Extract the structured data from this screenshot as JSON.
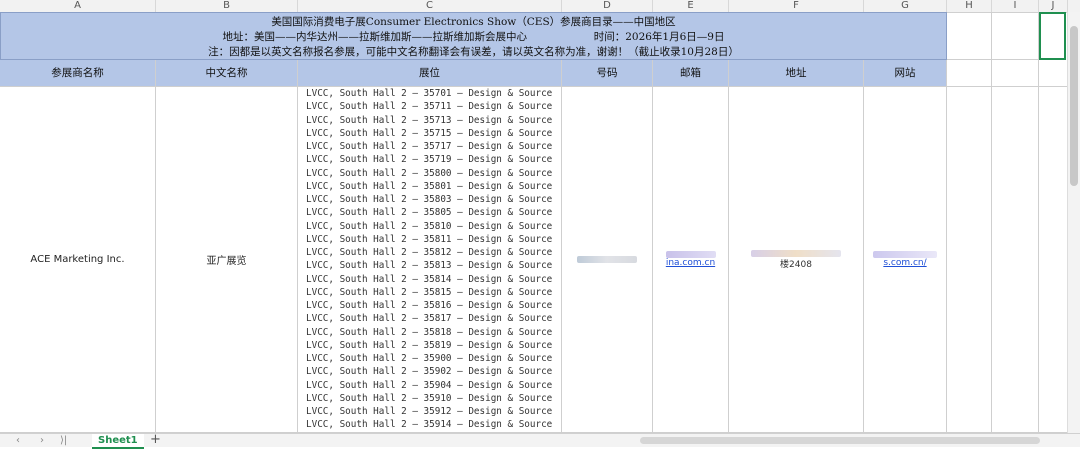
{
  "columns": [
    "A",
    "B",
    "C",
    "D",
    "E",
    "F",
    "G",
    "H",
    "I",
    "J"
  ],
  "title": {
    "line1": "美国国际消费电子展Consumer Electronics Show（CES）参展商目录——中国地区",
    "line2": "地址：美国——内华达州——拉斯维加斯——拉斯维加斯会展中心",
    "line2b": "时间：2026年1月6日—9日",
    "line3": "注：因都是以英文名称报名参展，可能中文名称翻译会有误差，请以英文名称为准，谢谢！（截止收录10月28日）"
  },
  "headers": [
    "参展商名称",
    "中文名称",
    "展位",
    "号码",
    "邮箱",
    "地址",
    "网站"
  ],
  "row": {
    "exhibitor": "ACE Marketing Inc.",
    "chinese_name": "亚广展览",
    "booths": [
      "LVCC, South Hall 2 — 35701 — Design & Source",
      "LVCC, South Hall 2 — 35711 — Design & Source",
      "LVCC, South Hall 2 — 35713 — Design & Source",
      "LVCC, South Hall 2 — 35715 — Design & Source",
      "LVCC, South Hall 2 — 35717 — Design & Source",
      "LVCC, South Hall 2 — 35719 — Design & Source",
      "LVCC, South Hall 2 — 35800 — Design & Source",
      "LVCC, South Hall 2 — 35801 — Design & Source",
      "LVCC, South Hall 2 — 35803 — Design & Source",
      "LVCC, South Hall 2 — 35805 — Design & Source",
      "LVCC, South Hall 2 — 35810 — Design & Source",
      "LVCC, South Hall 2 — 35811 — Design & Source",
      "LVCC, South Hall 2 — 35812 — Design & Source",
      "LVCC, South Hall 2 — 35813 — Design & Source",
      "LVCC, South Hall 2 — 35814 — Design & Source",
      "LVCC, South Hall 2 — 35815 — Design & Source",
      "LVCC, South Hall 2 — 35816 — Design & Source",
      "LVCC, South Hall 2 — 35817 — Design & Source",
      "LVCC, South Hall 2 — 35818 — Design & Source",
      "LVCC, South Hall 2 — 35819 — Design & Source",
      "LVCC, South Hall 2 — 35900 — Design & Source",
      "LVCC, South Hall 2 — 35902 — Design & Source",
      "LVCC, South Hall 2 — 35904 — Design & Source",
      "LVCC, South Hall 2 — 35910 — Design & Source",
      "LVCC, South Hall 2 — 35912 — Design & Source",
      "LVCC, South Hall 2 — 35914 — Design & Source"
    ],
    "email_tail": "ina.com.cn",
    "address_tail": "楼2408",
    "website_tail": "s.com.cn/"
  },
  "sheet_tab": "Sheet1",
  "nav": {
    "prev": "‹",
    "next": "›",
    "last": "⟩|",
    "add": "+"
  },
  "colors": {
    "header_bg": "#b4c6e7",
    "link": "#1f4fd6",
    "tab_accent": "#1f8f4f"
  }
}
